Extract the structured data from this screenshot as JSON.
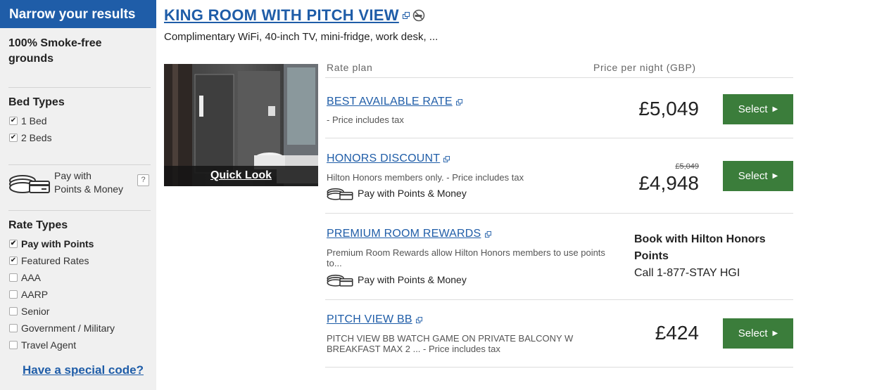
{
  "sidebar": {
    "header": "Narrow your results",
    "smoke_free": "100% Smoke-free grounds",
    "bed_types": {
      "heading": "Bed Types",
      "options": [
        {
          "label": "1 Bed",
          "checked": true
        },
        {
          "label": "2 Beds",
          "checked": true
        }
      ]
    },
    "points_money": {
      "label_line1": "Pay with",
      "label_line2": "Points & Money",
      "help": "?"
    },
    "rate_types": {
      "heading": "Rate Types",
      "options": [
        {
          "label": "Pay with Points",
          "checked": true
        },
        {
          "label": "Featured Rates",
          "checked": true
        },
        {
          "label": "AAA",
          "checked": false
        },
        {
          "label": "AARP",
          "checked": false
        },
        {
          "label": "Senior",
          "checked": false
        },
        {
          "label": "Government / Military",
          "checked": false
        },
        {
          "label": "Travel Agent",
          "checked": false
        }
      ]
    },
    "special_code": "Have a special code?"
  },
  "room": {
    "title": "KING ROOM WITH PITCH VIEW",
    "description": "Complimentary WiFi, 40-inch TV, mini-fridge, work desk, ...",
    "quick_look": "Quick Look"
  },
  "table": {
    "col_rate_plan": "Rate plan",
    "col_price": "Price per night (GBP)"
  },
  "rates": [
    {
      "name": "BEST AVAILABLE RATE",
      "sub": "- Price includes tax",
      "price": "£5,049",
      "select": "Select"
    },
    {
      "name": "HONORS DISCOUNT",
      "sub": "Hilton Honors members only. - Price includes tax",
      "pm": "Pay with Points & Money",
      "old_price": "£5,049",
      "price": "£4,948",
      "select": "Select"
    },
    {
      "name": "PREMIUM ROOM REWARDS",
      "sub": "Premium Room Rewards allow Hilton Honors members to use points to...",
      "pm": "Pay with Points & Money",
      "book_line1": "Book with Hilton Honors Points",
      "book_line2": "Call 1-877-STAY HGI"
    },
    {
      "name": "PITCH VIEW BB",
      "sub": "PITCH VIEW BB WATCH GAME ON PRIVATE BALCONY W BREAKFAST MAX 2 ... - Price includes tax",
      "price": "£424",
      "select": "Select"
    }
  ],
  "colors": {
    "brand_blue": "#1f5da8",
    "select_green": "#3b7d3b"
  }
}
